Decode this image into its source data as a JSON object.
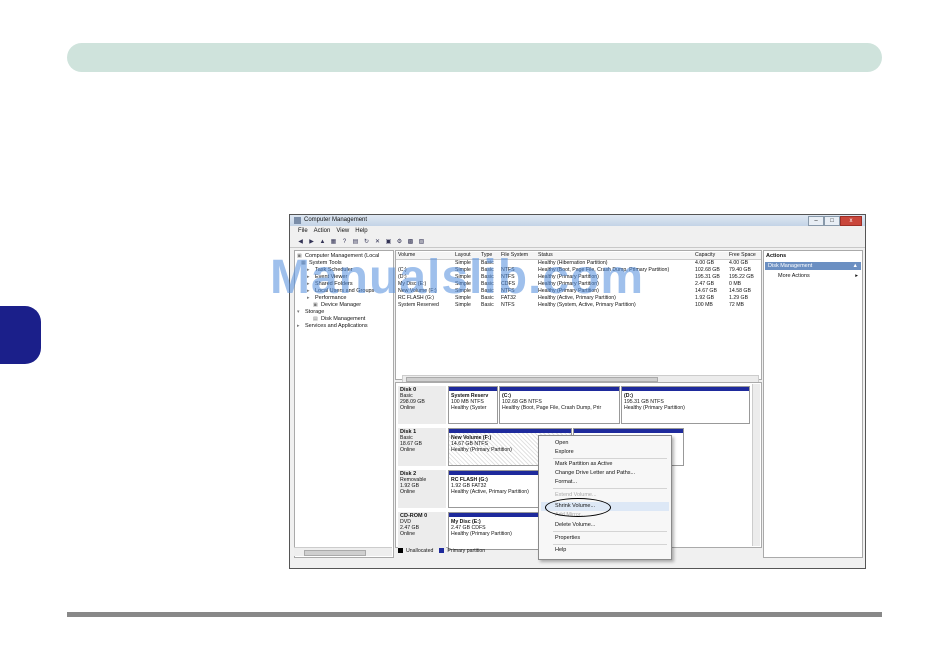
{
  "window": {
    "title": "Computer Management",
    "controls": {
      "minimize": "–",
      "maximize": "□",
      "close": "x"
    }
  },
  "menu": [
    "File",
    "Action",
    "View",
    "Help"
  ],
  "toolbar_icons": [
    "back-arrow-icon",
    "forward-arrow-icon",
    "up-folder-icon",
    "show-hide-tree-icon",
    "help-icon",
    "properties-icon",
    "refresh-icon",
    "delete-icon",
    "connect-icon",
    "settings-icon",
    "rescan-icon",
    "export-icon"
  ],
  "tree": [
    {
      "label": "Computer Management (Local",
      "indent": 0
    },
    {
      "label": "System Tools",
      "indent": 1
    },
    {
      "label": "Task Scheduler",
      "indent": 2
    },
    {
      "label": "Event Viewer",
      "indent": 2
    },
    {
      "label": "Shared Folders",
      "indent": 2
    },
    {
      "label": "Local Users and Groups",
      "indent": 2
    },
    {
      "label": "Performance",
      "indent": 2
    },
    {
      "label": "Device Manager",
      "indent": 2
    },
    {
      "label": "Storage",
      "indent": 1
    },
    {
      "label": "Disk Management",
      "indent": 2
    },
    {
      "label": "Services and Applications",
      "indent": 1
    }
  ],
  "volumes": {
    "headers": [
      "Volume",
      "Layout",
      "Type",
      "File System",
      "Status",
      "Capacity",
      "Free Space"
    ],
    "rows": [
      [
        "",
        "Simple",
        "Basic",
        "",
        "Healthy (Hibernation Partition)",
        "4.00 GB",
        "4.00 GB"
      ],
      [
        "(C:)",
        "Simple",
        "Basic",
        "NTFS",
        "Healthy (Boot, Page File, Crash Dump, Primary Partition)",
        "102.68 GB",
        "79.40 GB"
      ],
      [
        "(D:)",
        "Simple",
        "Basic",
        "NTFS",
        "Healthy (Primary Partition)",
        "195.31 GB",
        "195.22 GB"
      ],
      [
        "My Disc (E:)",
        "Simple",
        "Basic",
        "CDFS",
        "Healthy (Primary Partition)",
        "2.47 GB",
        "0 MB"
      ],
      [
        "New Volume (F:)",
        "Simple",
        "Basic",
        "NTFS",
        "Healthy (Primary Partition)",
        "14.67 GB",
        "14.58 GB"
      ],
      [
        "RC FLASH (G:)",
        "Simple",
        "Basic",
        "FAT32",
        "Healthy (Active, Primary Partition)",
        "1.92 GB",
        "1.29 GB"
      ],
      [
        "System Reserved",
        "Simple",
        "Basic",
        "NTFS",
        "Healthy (System, Active, Primary Partition)",
        "100 MB",
        "72 MB"
      ]
    ]
  },
  "disks": [
    {
      "name": "Disk 0",
      "type": "Basic",
      "size": "298.09 GB",
      "state": "Online",
      "partitions": [
        {
          "title": "System Reserv",
          "line2": "100 MB NTFS",
          "line3": "Healthy (Syster"
        },
        {
          "title": "(C:)",
          "line2": "102.68 GB NTFS",
          "line3": "Healthy (Boot, Page File, Crash Dump, Prir"
        },
        {
          "title": "(D:)",
          "line2": "195.31 GB NTFS",
          "line3": "Healthy (Primary Partition)"
        }
      ]
    },
    {
      "name": "Disk 1",
      "type": "Basic",
      "size": "18.67 GB",
      "state": "Online",
      "partitions": [
        {
          "title": "New Volume (F:)",
          "line2": "14.67 GB NTFS",
          "line3": "Healthy (Primary Partition)"
        }
      ]
    },
    {
      "name": "Disk 2",
      "type": "Removable",
      "size": "1.92 GB",
      "state": "Online",
      "partitions": [
        {
          "title": "RC FLASH (G:)",
          "line2": "1.92 GB FAT32",
          "line3": "Healthy (Active, Primary Partition)"
        }
      ]
    },
    {
      "name": "CD-ROM 0",
      "type": "DVD",
      "size": "2.47 GB",
      "state": "Online",
      "partitions": [
        {
          "title": "My Disc (E:)",
          "line2": "2.47 GB CDFS",
          "line3": "Healthy (Primary Partition)"
        }
      ]
    }
  ],
  "legend": [
    {
      "label": "Unallocated",
      "color": "#000000"
    },
    {
      "label": "Primary partition",
      "color": "#1e2a9c"
    }
  ],
  "actions": {
    "header": "Actions",
    "selected": "Disk Management",
    "more": "More Actions"
  },
  "context_menu": [
    {
      "label": "Open",
      "enabled": true
    },
    {
      "label": "Explore",
      "enabled": true
    },
    {
      "label": "Mark Partition as Active",
      "enabled": true
    },
    {
      "label": "Change Drive Letter and Paths...",
      "enabled": true
    },
    {
      "label": "Format...",
      "enabled": true
    },
    {
      "label": "Extend Volume...",
      "enabled": false
    },
    {
      "label": "Shrink Volume...",
      "enabled": true
    },
    {
      "label": "Add Mirror...",
      "enabled": false
    },
    {
      "label": "Delete Volume...",
      "enabled": true
    },
    {
      "label": "Properties",
      "enabled": true
    },
    {
      "label": "Help",
      "enabled": true
    }
  ],
  "watermark": "Manualslib.com",
  "colors": {
    "header_bar": "#cfe3dc",
    "side_tab": "#1b1f8a",
    "partition_bar": "#1e2a9c",
    "selection": "#6b8fc2"
  }
}
